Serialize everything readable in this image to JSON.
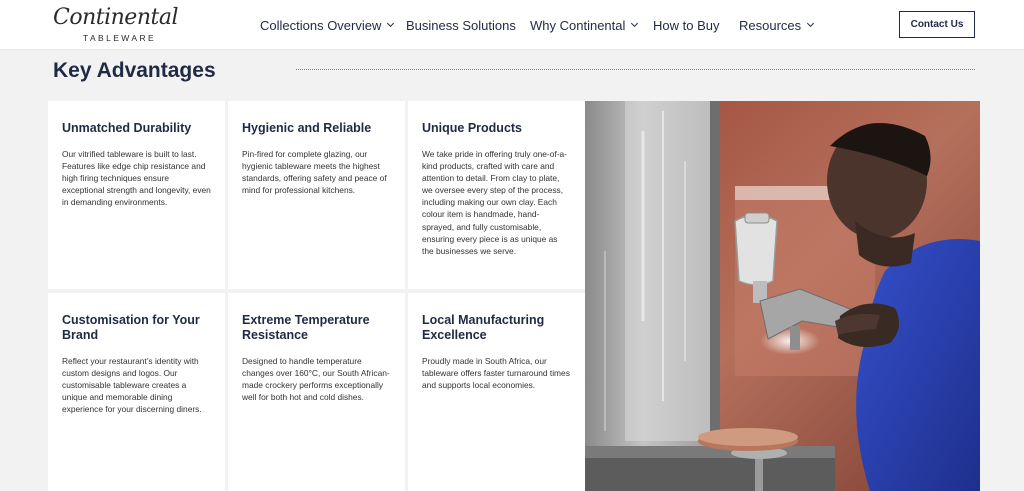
{
  "header": {
    "logo": {
      "script": "Continental",
      "sub": "TABLEWARE"
    },
    "nav": [
      {
        "label": "Collections Overview",
        "has_dropdown": true
      },
      {
        "label": "Business Solutions",
        "has_dropdown": false
      },
      {
        "label": "Why Continental",
        "has_dropdown": true
      },
      {
        "label": "How to Buy",
        "has_dropdown": false
      },
      {
        "label": "Resources",
        "has_dropdown": true
      }
    ],
    "contact_label": "Contact Us"
  },
  "section": {
    "title": "Key Advantages",
    "cards": [
      {
        "title": "Unmatched Durability",
        "text": "Our vitrified tableware is built to last. Features like edge chip resistance and high firing techniques ensure exceptional strength and longevity, even in demanding environments."
      },
      {
        "title": "Hygienic and Reliable",
        "text": "Pin-fired for complete glazing, our hygienic tableware meets the highest standards, offering safety and peace of mind for professional kitchens."
      },
      {
        "title": "Unique Products",
        "text": "We take pride in offering truly one-of-a-kind products, crafted with care and attention to detail. From clay to plate, we oversee every step of the process, including making our own clay. Each colour item is handmade, hand-sprayed, and fully customisable, ensuring every piece is as unique as the businesses we serve."
      },
      {
        "title": "Customisation for Your Brand",
        "text": "Reflect your restaurant’s identity with custom designs and logos. Our customisable tableware creates a unique and memorable dining experience for your discerning diners."
      },
      {
        "title": "Extreme Temperature Resistance",
        "text": "Designed to handle temperature changes over 160°C, our South African-made crockery performs exceptionally well for both hot and cold dishes."
      },
      {
        "title": "Local Manufacturing Excellence",
        "text": "Proudly made in South Africa, our tableware offers faster turnaround times and supports local economies."
      }
    ]
  },
  "colors": {
    "navy": "#1f2a44",
    "page_background": "#f2f2f2",
    "card_background": "#ffffff",
    "worker_shirt": "#2a43b5"
  },
  "icons": [
    "chevron-down-icon"
  ]
}
